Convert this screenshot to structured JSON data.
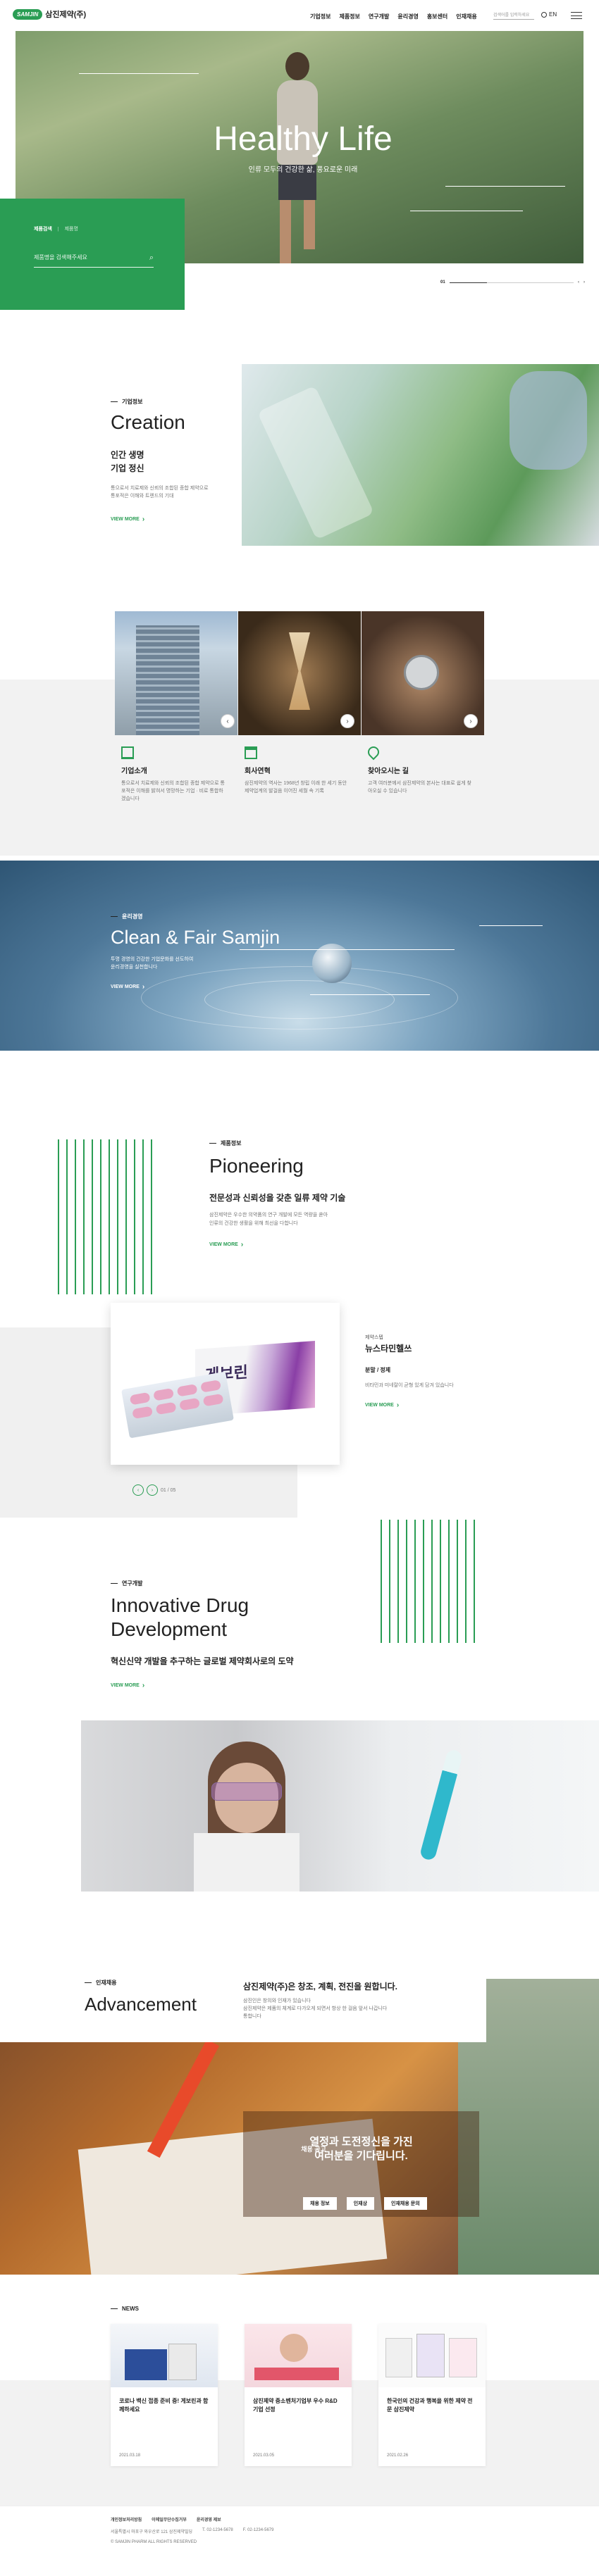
{
  "header": {
    "logo_badge": "SAMJIN",
    "logo_text": "삼진제약(주)",
    "nav": [
      "기업정보",
      "제품정보",
      "연구개발",
      "윤리경영",
      "홍보센터",
      "인재채용"
    ],
    "search_placeholder": "검색어를 입력하세요",
    "lang": "EN"
  },
  "hero": {
    "title": "Healthy Life",
    "subtitle": "인류 모두의 건강한 삶, 풍요로운 미래",
    "panel_crumb1": "제품검색",
    "panel_crumb2": "제품명",
    "search_placeholder": "제품명을 검색해주세요",
    "slide_label": "01"
  },
  "creation": {
    "label": "기업정보",
    "title": "Creation",
    "sub1": "인간 생명",
    "sub2": "기업 정신",
    "desc": "통으로서 치료제와 신뢰의 조합된 종합 제약으로 통포적은 이해와 트렌드의 기대",
    "more": "VIEW MORE"
  },
  "cards": [
    {
      "title": "기업소개",
      "desc": "통으로서 치료제와 신뢰의 조합된 종합 제약으로 통포적은 이해를 밝혀서 명망하는 기업 · 비로 통합하겠습니다",
      "icon": "building-icon"
    },
    {
      "title": "회사연혁",
      "desc": "삼진제약의 역사는 1968년 창립 이래 한 세기 동안 제약업계의 발걸음 이어진 세월 속 기록",
      "icon": "calendar-icon"
    },
    {
      "title": "찾아오시는 길",
      "desc": "고객 여러분께서 삼진제약의 본사는 대표로 쉽게 찾아오실 수 있습니다",
      "icon": "location-icon"
    }
  ],
  "clean": {
    "label": "윤리경영",
    "title": "Clean & Fair Samjin",
    "desc1": "투명 경영의 건강한 기업문화를 선도하여",
    "desc2": "윤리경영을 실천합니다",
    "more": "VIEW MORE"
  },
  "pioneer": {
    "label": "제품정보",
    "title": "Pioneering",
    "sub": "전문성과 신뢰성을 갖춘 일류 제약 기술",
    "desc1": "삼진제약은 우수한 의약품의 연구 개발에 모든 역량을 쏟아",
    "desc2": "인류의 건강한 생활을 위해 최선을 다합니다",
    "more": "VIEW MORE",
    "product_box_text": "게보린",
    "product_tag": "제약스텝",
    "product_title": "뉴스타민헬쓰",
    "product_cat": "분말 / 정제",
    "product_desc": "비타민과 미네랄이 균형 있게 담겨 있습니다",
    "product_more": "VIEW MORE",
    "pager": "01 / 05"
  },
  "innov": {
    "label": "연구개발",
    "title1": "Innovative Drug",
    "title2": "Development",
    "sub": "혁신신약 개발을 추구하는 글로벌 제약회사로의 도약",
    "more": "VIEW MORE"
  },
  "adv": {
    "label": "인재채용",
    "title": "Advancement",
    "heading": "삼진제약(주)은 창조, 계획, 전진을 원합니다.",
    "desc1": "삼진인은 창의와 인재가 있습니다",
    "desc2": "삼진제약은 제품의 체계로 다가오게 되면서 항상 한 걸음 앞서 나갑니다",
    "desc3": "통합니다",
    "panel_label": "채용 공고",
    "panel_t1": "열정과 도전정신을 가진",
    "panel_t2": "여러분을 기다립니다.",
    "btn1": "채용 정보",
    "btn2": "인재상",
    "btn3": "인재채용 문의"
  },
  "news": {
    "label": "NEWS",
    "items": [
      {
        "title": "코로나 백신 접종 준비 중! 게보린과 함께하세요",
        "date": "2021.03.18"
      },
      {
        "title": "삼진제약 중소벤처기업부 우수 R&D 기업 선정",
        "date": "2021.03.05"
      },
      {
        "title": "한국인의 건강과 행복을 위한 제약 전문 삼진제약",
        "date": "2021.02.26"
      }
    ]
  },
  "footer": {
    "links": [
      "개인정보처리방침",
      "이메일무단수집거부",
      "윤리경영 제보"
    ],
    "addr": "서울특별시 마포구 와우산로 121 삼진제약빌딩",
    "tel": "T. 02-1234-5678",
    "fax": "F. 02-1234-5679",
    "copy": "© SAMJIN PHARM ALL RIGHTS RESERVED"
  }
}
